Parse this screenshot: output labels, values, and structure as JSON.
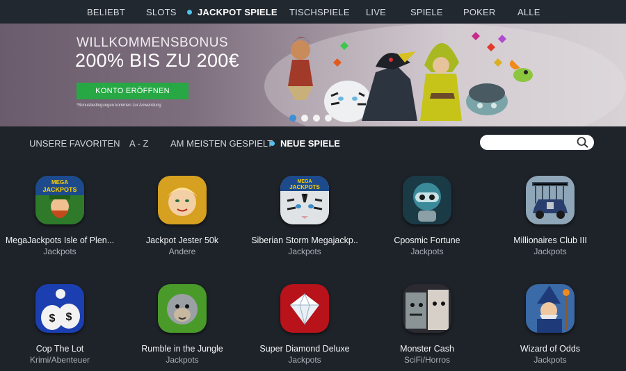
{
  "nav": {
    "items": [
      {
        "label": "BELIEBT",
        "active": false
      },
      {
        "label": "SLOTS",
        "active": false
      },
      {
        "label": "JACKPOT SPIELE",
        "active": true
      },
      {
        "label": "TISCHSPIELE",
        "active": false
      },
      {
        "label": "LIVE",
        "active": false
      },
      {
        "label": "SPIELE",
        "active": false
      },
      {
        "label": "POKER",
        "active": false
      },
      {
        "label": "ALLE",
        "active": false
      }
    ]
  },
  "banner": {
    "title": "WILLKOMMENSBONUS",
    "subtitle": "200% BIS ZU 200€",
    "cta_label": "KONTO ERÖFFNEN",
    "terms": "*Bonusbedingungen kommen zur Anwendung",
    "slides_count": 4,
    "active_slide": 1
  },
  "filters": {
    "items": [
      {
        "label": "UNSERE FAVORITEN",
        "active": false
      },
      {
        "label": "A - Z",
        "active": false
      },
      {
        "label": "AM MEISTEN GESPIELT",
        "active": false
      },
      {
        "label": "NEUE SPIELE",
        "active": true
      }
    ],
    "search_placeholder": ""
  },
  "games": [
    {
      "name": "MegaJackpots Isle of Plen...",
      "category": "Jackpots",
      "icon": "leprechaun-icon"
    },
    {
      "name": "Jackpot Jester 50k",
      "category": "Andere",
      "icon": "jester-icon"
    },
    {
      "name": "Siberian Storm Megajackp..",
      "category": "Jackpots",
      "icon": "white-tiger-icon"
    },
    {
      "name": "Cposmic Fortune",
      "category": "Jackpots",
      "icon": "alien-robot-icon"
    },
    {
      "name": "Millionaires Club III",
      "category": "Jackpots",
      "icon": "vintage-car-icon"
    },
    {
      "name": "Cop The Lot",
      "category": "Krimi/Abenteuer",
      "icon": "money-bags-icon"
    },
    {
      "name": "Rumble in the Jungle",
      "category": "Jackpots",
      "icon": "gorilla-icon"
    },
    {
      "name": "Super Diamond Deluxe",
      "category": "Jackpots",
      "icon": "diamond-icon"
    },
    {
      "name": "Monster Cash",
      "category": "SciFi/Horros",
      "icon": "monster-icon"
    },
    {
      "name": "Wizard of Odds",
      "category": "Jackpots",
      "icon": "wizard-icon"
    }
  ],
  "colors": {
    "accent": "#4fc3ec",
    "cta": "#27a844",
    "background": "#1e2329"
  }
}
